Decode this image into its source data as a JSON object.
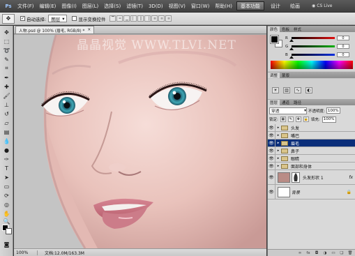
{
  "menubar": {
    "logo": "Ps",
    "menus": [
      "文件(F)",
      "编辑(E)",
      "图像(I)",
      "图层(L)",
      "选择(S)",
      "滤镜(T)",
      "3D(D)",
      "视图(V)",
      "窗口(W)",
      "帮助(H)"
    ],
    "zoom": "100%",
    "workspaces": [
      "基本功能",
      "设计",
      "绘画"
    ],
    "active_workspace": "基本功能",
    "cs_live": "CS Live"
  },
  "options_bar": {
    "auto_select_label": "自动选择:",
    "auto_select_checked": true,
    "auto_select_value": "图层",
    "show_transform_label": "显示变换控件",
    "show_transform_checked": false
  },
  "document": {
    "tab_title": "人物.psd @ 100% (眉毛, RGB/8) *",
    "close_glyph": "×",
    "watermark": "晶晶视觉 WWW.TLVI.NET",
    "status_zoom": "100%",
    "status_doc": "文档:12.0M/163.3M"
  },
  "color_panel": {
    "tabs": [
      "颜色",
      "色板",
      "样式"
    ],
    "active_tab": "颜色",
    "sliders": [
      {
        "label": "R",
        "value": "0",
        "color": "#e01010"
      },
      {
        "label": "G",
        "value": "0",
        "color": "#10b010"
      },
      {
        "label": "B",
        "value": "0",
        "color": "#1030e0"
      }
    ]
  },
  "adjust_panel": {
    "tabs": [
      "调整",
      "蒙版"
    ],
    "active_tab": "调整"
  },
  "layers_panel": {
    "tabs": [
      "图层",
      "通道",
      "路径"
    ],
    "active_tab": "图层",
    "blend_mode": "穿透",
    "opacity_label": "不透明度:",
    "opacity_value": "100%",
    "lock_label": "锁定:",
    "fill_label": "填充:",
    "fill_value": "100%",
    "layers": [
      {
        "name": "头发",
        "kind": "group",
        "selected": false
      },
      {
        "name": "嘴巴",
        "kind": "group",
        "selected": false
      },
      {
        "name": "眉毛",
        "kind": "group",
        "selected": true
      },
      {
        "name": "鼻子",
        "kind": "group",
        "selected": false
      },
      {
        "name": "眼睛",
        "kind": "group",
        "selected": false
      },
      {
        "name": "面部和身体",
        "kind": "group",
        "selected": false
      },
      {
        "name": "头发形状 1",
        "kind": "shape",
        "selected": false,
        "fx": "fx"
      },
      {
        "name": "背景",
        "kind": "background",
        "selected": false
      }
    ]
  },
  "colors": {
    "accent_selected": "#0b2e7a",
    "foreground": "#000000",
    "background": "#ffffff"
  }
}
